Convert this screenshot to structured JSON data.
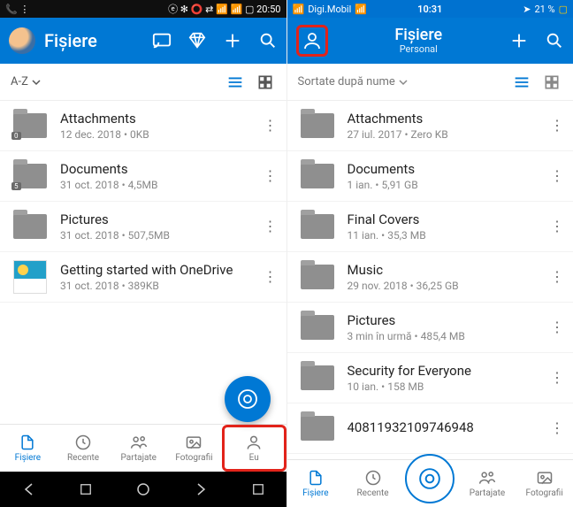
{
  "left": {
    "status": {
      "left_icons": "📞 ⋮",
      "right": "ⓔ ✻ ⭕ ⇄ 📶 📶 ▢ 20:50",
      "time": "20:50"
    },
    "title": "Fișiere",
    "sort_label": "A-Z",
    "files": [
      {
        "name": "Attachments",
        "sub": "12 dec. 2018 • 0KB",
        "badge": "0",
        "type": "folder"
      },
      {
        "name": "Documents",
        "sub": "31 oct. 2018 • 4,5MB",
        "badge": "5",
        "type": "folder"
      },
      {
        "name": "Pictures",
        "sub": "31 oct. 2018 • 507,5MB",
        "type": "folder"
      },
      {
        "name": "Getting started with OneDrive",
        "sub": "31 oct. 2018 • 389KB",
        "type": "file"
      }
    ],
    "nav": [
      "Fișiere",
      "Recente",
      "Partajate",
      "Fotografii",
      "Eu"
    ]
  },
  "right": {
    "status": {
      "carrier_signal": "📶",
      "carrier": "Digi.Mobil",
      "wifi": "📶",
      "time": "10:31",
      "loc": "➤",
      "battery": "21 %",
      "batt_icon": "▢"
    },
    "title": "Fișiere",
    "subtitle": "Personal",
    "sort_label": "Sortate după nume",
    "files": [
      {
        "name": "Attachments",
        "sub": "27 iul. 2017 • Zero KB"
      },
      {
        "name": "Documents",
        "sub": "1 ian. • 5,91 GB"
      },
      {
        "name": "Final Covers",
        "sub": "11 ian. • 35,3 MB"
      },
      {
        "name": "Music",
        "sub": "29 nov. 2018 • 36,25 GB"
      },
      {
        "name": "Pictures",
        "sub": "3 min în urmă • 485,4 MB"
      },
      {
        "name": "Security for Everyone",
        "sub": "10 ian. • 158 MB"
      },
      {
        "name": "40811932109746948",
        "sub": ""
      }
    ],
    "nav": [
      "Fișiere",
      "Recente",
      "",
      "Partajate",
      "Fotografii"
    ]
  }
}
